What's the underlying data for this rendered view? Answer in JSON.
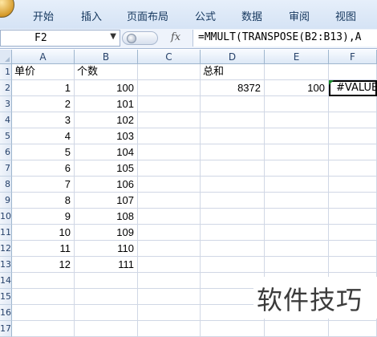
{
  "ribbon": {
    "tabs": [
      "开始",
      "插入",
      "页面布局",
      "公式",
      "数据",
      "审阅",
      "视图"
    ]
  },
  "formula_bar": {
    "name_box": "F2",
    "fx_label": "fx",
    "formula": "=MMULT(TRANSPOSE(B2:B13),A"
  },
  "sheet": {
    "columns": [
      "A",
      "B",
      "C",
      "D",
      "E",
      "F"
    ],
    "row_numbers": [
      "1",
      "2",
      "3",
      "4",
      "5",
      "6",
      "7",
      "8",
      "9",
      "10",
      "11",
      "12",
      "13",
      "14",
      "15",
      "16",
      "17"
    ],
    "header_row": {
      "A": "单价",
      "B": "个数",
      "D": "总和"
    },
    "summary_row": {
      "D": "8372",
      "E": "100",
      "F": "#VALUE"
    },
    "data_rows": [
      {
        "a": "1",
        "b": "100"
      },
      {
        "a": "2",
        "b": "101"
      },
      {
        "a": "3",
        "b": "102"
      },
      {
        "a": "4",
        "b": "103"
      },
      {
        "a": "5",
        "b": "104"
      },
      {
        "a": "6",
        "b": "105"
      },
      {
        "a": "7",
        "b": "106"
      },
      {
        "a": "8",
        "b": "107"
      },
      {
        "a": "9",
        "b": "108"
      },
      {
        "a": "10",
        "b": "109"
      },
      {
        "a": "11",
        "b": "110"
      },
      {
        "a": "12",
        "b": "111"
      }
    ],
    "selected_cell": "F2"
  },
  "watermark": "软件技巧",
  "colors": {
    "ribbon_tab_text": "#15375e",
    "error_indicator": "#1c8a2e",
    "grid_line": "#d0d7e5"
  }
}
